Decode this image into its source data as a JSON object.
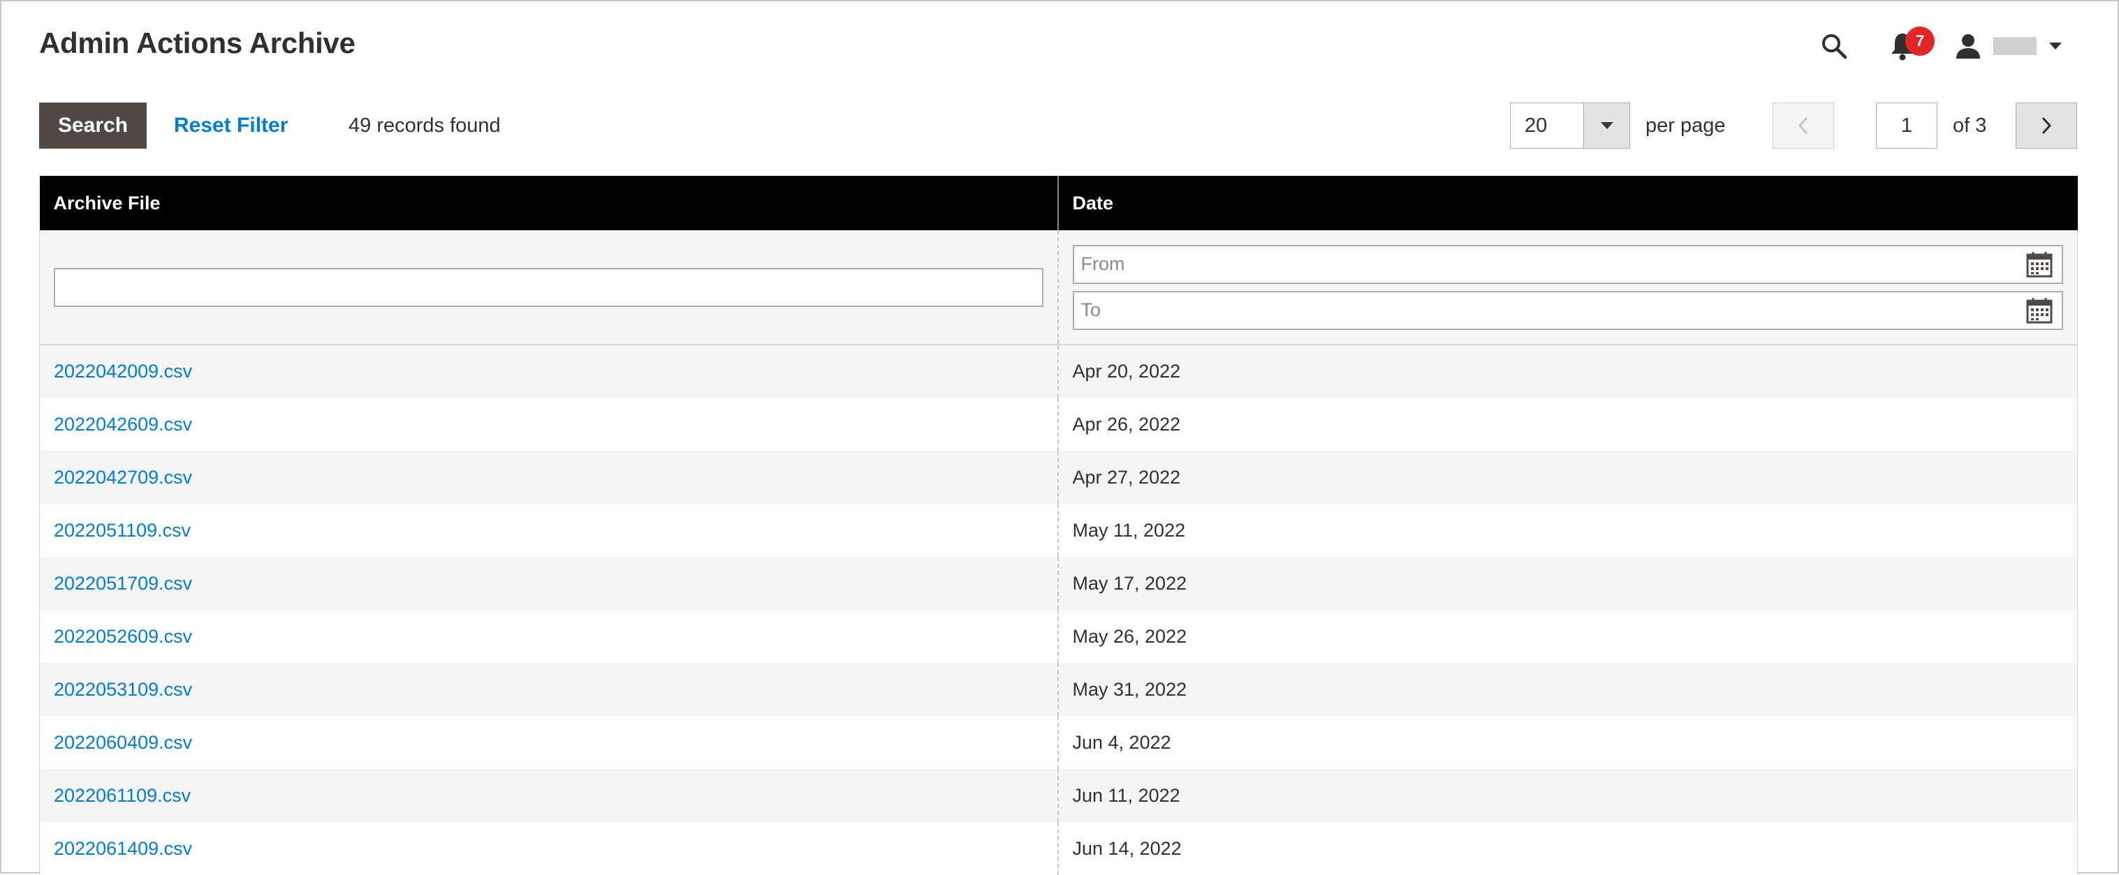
{
  "header": {
    "title": "Admin Actions Archive",
    "notification_count": "7",
    "icons": {
      "search": "search-icon",
      "notifications": "bell-icon",
      "user": "user-icon",
      "user_menu": "caret-down-icon"
    }
  },
  "toolbar": {
    "search_label": "Search",
    "reset_label": "Reset Filter",
    "records_found": "49 records found",
    "per_page_value": "20",
    "per_page_label": "per page",
    "current_page": "1",
    "of_pages": "of 3"
  },
  "grid": {
    "columns": [
      "Archive File",
      "Date"
    ],
    "filters": {
      "file_value": "",
      "date_from_placeholder": "From",
      "date_to_placeholder": "To"
    },
    "rows": [
      {
        "file": "2022042009.csv",
        "date": "Apr 20, 2022"
      },
      {
        "file": "2022042609.csv",
        "date": "Apr 26, 2022"
      },
      {
        "file": "2022042709.csv",
        "date": "Apr 27, 2022"
      },
      {
        "file": "2022051109.csv",
        "date": "May 11, 2022"
      },
      {
        "file": "2022051709.csv",
        "date": "May 17, 2022"
      },
      {
        "file": "2022052609.csv",
        "date": "May 26, 2022"
      },
      {
        "file": "2022053109.csv",
        "date": "May 31, 2022"
      },
      {
        "file": "2022060409.csv",
        "date": "Jun 4, 2022"
      },
      {
        "file": "2022061109.csv",
        "date": "Jun 11, 2022"
      },
      {
        "file": "2022061409.csv",
        "date": "Jun 14, 2022"
      }
    ]
  },
  "colors": {
    "link": "#007bdb",
    "primary_button": "#514943",
    "header_bg": "#000000",
    "badge": "#e22626"
  }
}
